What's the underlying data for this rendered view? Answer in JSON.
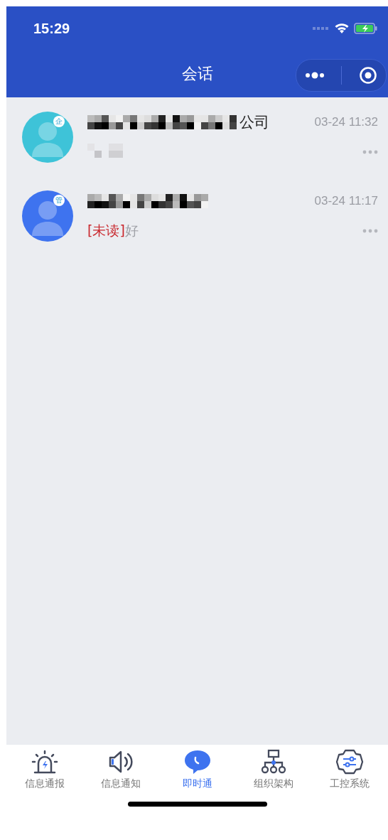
{
  "status_bar": {
    "time": "15:29"
  },
  "nav": {
    "title": "会话"
  },
  "conversations": [
    {
      "badge": "企",
      "color": "#3ec3d8",
      "name_redacted": true,
      "name": "公司",
      "preview_redacted": true,
      "time": "03-24 11:32"
    },
    {
      "badge": "管",
      "color": "#3e73ef",
      "name_redacted": true,
      "preview_redacted": false,
      "time": "03-24 11:17",
      "unread_tag": "[未读]",
      "preview": "好"
    }
  ],
  "tabs": [
    {
      "label": "信息通报",
      "kind": "alarm",
      "selected": false
    },
    {
      "label": "信息通知",
      "kind": "speaker",
      "selected": false
    },
    {
      "label": "即时通",
      "kind": "chat",
      "selected": true
    },
    {
      "label": "组织架构",
      "kind": "org",
      "selected": false
    },
    {
      "label": "工控系统",
      "kind": "gear",
      "selected": false
    }
  ]
}
